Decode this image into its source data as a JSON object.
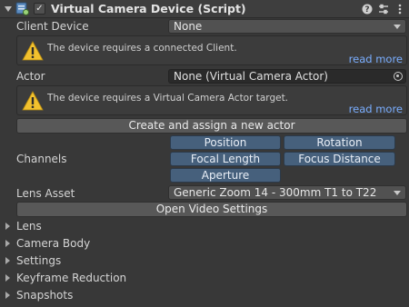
{
  "component": {
    "title": "Virtual Camera Device (Script)",
    "enabled": true,
    "enabled_glyph": "✓",
    "header_buttons": [
      "help-icon",
      "presets-icon",
      "more-options-icon"
    ]
  },
  "client_device": {
    "label": "Client Device",
    "value": "None",
    "help_text": "The device requires a connected Client.",
    "read_more": "read more"
  },
  "actor": {
    "label": "Actor",
    "value": "None (Virtual Camera Actor)",
    "help_text": "The device requires a Virtual Camera Actor target.",
    "read_more": "read more"
  },
  "create_actor_button": "Create and assign a new actor",
  "channels": {
    "label": "Channels",
    "buttons": [
      "Position",
      "Rotation",
      "Focal Length",
      "Focus Distance",
      "Aperture"
    ]
  },
  "lens_asset": {
    "label": "Lens Asset",
    "value": "Generic Zoom 14 - 300mm T1 to T22"
  },
  "open_video_settings_button": "Open Video Settings",
  "foldouts": [
    "Lens",
    "Camera Body",
    "Settings",
    "Keyframe Reduction",
    "Snapshots"
  ],
  "colors": {
    "background": "#383838",
    "channel_button": "#46607c",
    "link": "#7aaeff",
    "warning": "#f2c12e"
  }
}
